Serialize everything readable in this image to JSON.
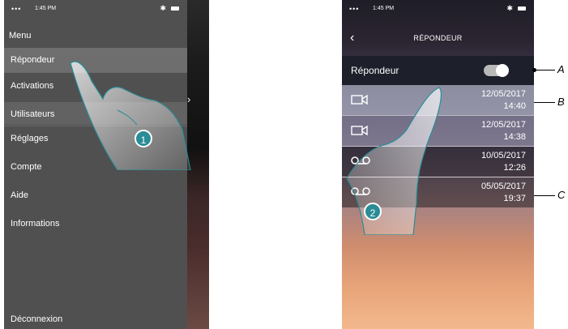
{
  "left_phone": {
    "status": {
      "time": "1:45 PM"
    },
    "menu_title": "Menu",
    "items": [
      {
        "label": "Répondeur"
      },
      {
        "label": "Activations"
      },
      {
        "label": "Utilisateurs"
      },
      {
        "label": "Réglages"
      },
      {
        "label": "Compte"
      },
      {
        "label": "Aide"
      },
      {
        "label": "Informations"
      }
    ],
    "logout": "Déconnexion",
    "step_number": "1"
  },
  "right_phone": {
    "status": {
      "time": "1:45 PM"
    },
    "title": "RÉPONDEUR",
    "toggle_label": "Répondeur",
    "toggle_on": true,
    "messages": [
      {
        "type": "video",
        "icon": "video-camera-icon",
        "date": "12/05/2017",
        "time": "14:40"
      },
      {
        "type": "video",
        "icon": "video-camera-icon",
        "date": "12/05/2017",
        "time": "14:38"
      },
      {
        "type": "audio",
        "icon": "voicemail-icon",
        "date": "10/05/2017",
        "time": "12:26"
      },
      {
        "type": "audio",
        "icon": "voicemail-icon",
        "date": "05/05/2017",
        "time": "19:37"
      }
    ],
    "step_number": "2"
  },
  "callouts": {
    "a": "A",
    "b": "B",
    "c": "C"
  },
  "colors": {
    "step_badge": "#2a8c96",
    "menu_bg": "#505050",
    "menu_highlight": "#6e6e6e"
  }
}
